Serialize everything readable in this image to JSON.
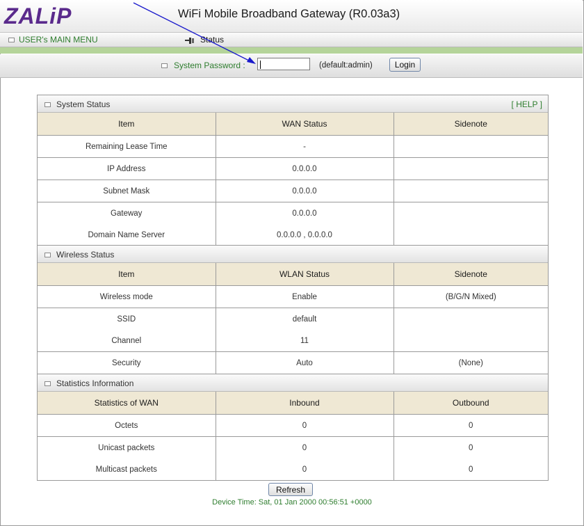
{
  "header": {
    "logo_text": "ZALiP",
    "title": "WiFi Mobile Broadband Gateway (R0.03a3)"
  },
  "menu": {
    "main_label": "USER's MAIN MENU",
    "status_label": "Status"
  },
  "login": {
    "label": "System Password :",
    "value": "",
    "default_hint": "(default:admin)",
    "button": "Login"
  },
  "system_status": {
    "title": "System Status",
    "help": "[ HELP ]",
    "headers": [
      "Item",
      "WAN Status",
      "Sidenote"
    ],
    "rows": [
      {
        "item": "Remaining Lease Time",
        "value": "-",
        "note": ""
      },
      {
        "item": "IP Address",
        "value": "0.0.0.0",
        "note": ""
      },
      {
        "item": "Subnet Mask",
        "value": "0.0.0.0",
        "note": ""
      },
      {
        "item": "Gateway",
        "value": "0.0.0.0",
        "note": ""
      },
      {
        "item": "Domain Name Server",
        "value": "0.0.0.0 , 0.0.0.0",
        "note": ""
      }
    ]
  },
  "wireless_status": {
    "title": "Wireless Status",
    "headers": [
      "Item",
      "WLAN Status",
      "Sidenote"
    ],
    "rows": [
      {
        "item": "Wireless mode",
        "value": "Enable",
        "note": "(B/G/N Mixed)"
      },
      {
        "item": "SSID",
        "value": "default",
        "note": ""
      },
      {
        "item": "Channel",
        "value": "11",
        "note": ""
      },
      {
        "item": "Security",
        "value": "Auto",
        "note": "(None)"
      }
    ]
  },
  "statistics": {
    "title": "Statistics Information",
    "headers": [
      "Statistics of WAN",
      "Inbound",
      "Outbound"
    ],
    "rows": [
      {
        "item": "Octets",
        "value": "0",
        "note": "0"
      },
      {
        "item": "Unicast packets",
        "value": "0",
        "note": "0"
      },
      {
        "item": "Multicast packets",
        "value": "0",
        "note": "0"
      }
    ]
  },
  "footer": {
    "refresh": "Refresh",
    "device_time": "Device Time: Sat, 01 Jan 2000 00:56:51 +0000"
  },
  "colors": {
    "accent_green": "#2e7d2e",
    "logo_purple": "#5a2a8c",
    "annotation_arrow": "#1a1acc",
    "table_header_bg": "#efe8d4",
    "green_band": "#b5d49a"
  },
  "icons": [
    "logo",
    "monitor-icon",
    "arrow-annotation"
  ]
}
